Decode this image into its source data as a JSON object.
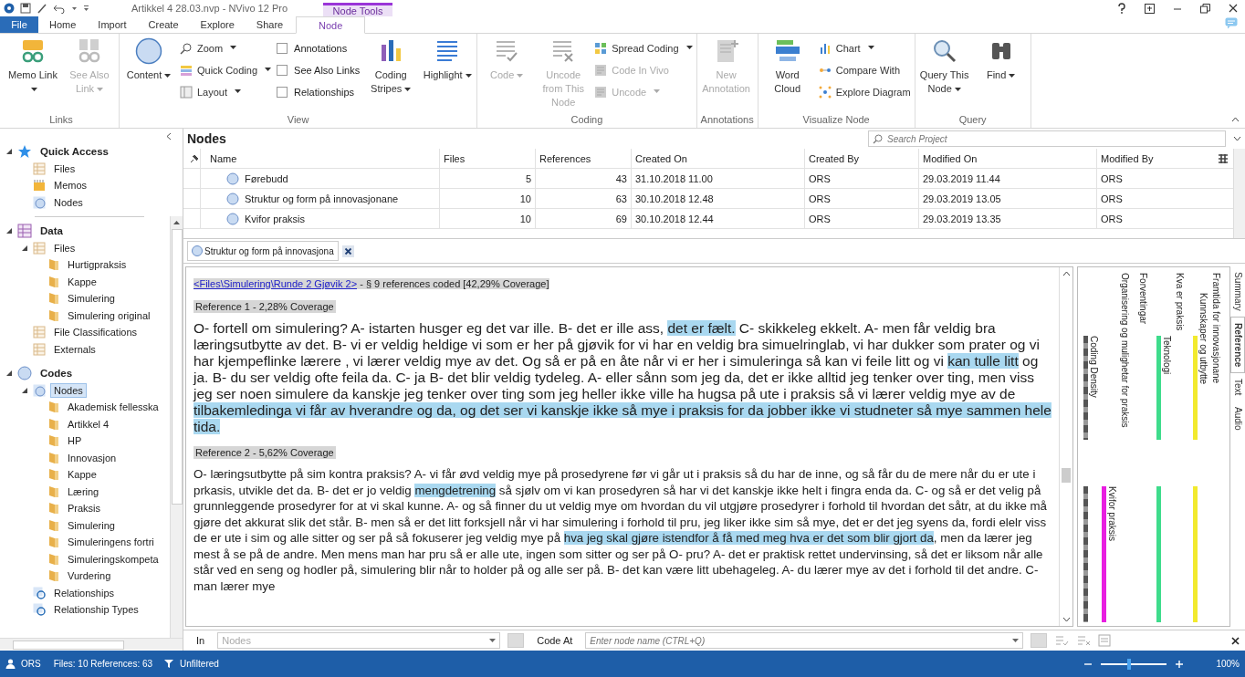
{
  "title_bar": {
    "title": "Artikkel 4 28.03.nvp - NVivo 12 Pro",
    "context_label": "Node Tools"
  },
  "tabs": [
    {
      "label": "File",
      "kind": "file",
      "selected": false
    },
    {
      "label": "Home",
      "kind": "normal",
      "selected": false
    },
    {
      "label": "Import",
      "kind": "normal",
      "selected": false
    },
    {
      "label": "Create",
      "kind": "normal",
      "selected": false
    },
    {
      "label": "Explore",
      "kind": "normal",
      "selected": false
    },
    {
      "label": "Share",
      "kind": "normal",
      "selected": false
    },
    {
      "label": "Node",
      "kind": "context",
      "selected": true
    }
  ],
  "ribbon": [
    {
      "label": "Links",
      "items": [
        {
          "kind": "large",
          "label": "Memo Link",
          "dropdown": true,
          "disabled": false
        },
        {
          "kind": "large",
          "label": "See Also Link",
          "dropdown": true,
          "disabled": true
        }
      ]
    },
    {
      "label": "View",
      "items": [
        {
          "kind": "large",
          "label": "Content",
          "dropdown": true,
          "disabled": false
        },
        {
          "kind": "stack",
          "items": [
            {
              "kind": "small",
              "label": "Zoom",
              "dropdown": true,
              "disabled": false
            },
            {
              "kind": "small",
              "label": "Quick Coding",
              "dropdown": true,
              "disabled": false
            },
            {
              "kind": "small",
              "label": "Layout",
              "dropdown": true,
              "disabled": false
            }
          ]
        },
        {
          "kind": "stack",
          "items": [
            {
              "kind": "check",
              "label": "Annotations",
              "checked": false
            },
            {
              "kind": "check",
              "label": "See Also Links",
              "checked": false
            },
            {
              "kind": "check",
              "label": "Relationships",
              "checked": false
            }
          ]
        },
        {
          "kind": "large",
          "label": "Coding Stripes",
          "dropdown": true,
          "disabled": false
        },
        {
          "kind": "large",
          "label": "Highlight",
          "dropdown": true,
          "disabled": false
        }
      ]
    },
    {
      "label": "Coding",
      "items": [
        {
          "kind": "large",
          "label": "Code",
          "dropdown": true,
          "disabled": true
        },
        {
          "kind": "large",
          "label": "Uncode from This Node",
          "dropdown": false,
          "disabled": true
        },
        {
          "kind": "stack",
          "items": [
            {
              "kind": "small",
              "label": "Spread Coding",
              "dropdown": true,
              "disabled": false
            },
            {
              "kind": "small",
              "label": "Code In Vivo",
              "dropdown": false,
              "disabled": true
            },
            {
              "kind": "small",
              "label": "Uncode",
              "dropdown": true,
              "disabled": true
            }
          ]
        }
      ]
    },
    {
      "label": "Annotations",
      "items": [
        {
          "kind": "large",
          "label": "New Annotation",
          "dropdown": false,
          "disabled": true
        }
      ]
    },
    {
      "label": "Visualize Node",
      "items": [
        {
          "kind": "large",
          "label": "Word Cloud",
          "dropdown": false,
          "disabled": false
        },
        {
          "kind": "stack",
          "items": [
            {
              "kind": "small",
              "label": "Chart",
              "dropdown": true,
              "disabled": false
            },
            {
              "kind": "small",
              "label": "Compare With",
              "dropdown": false,
              "disabled": false
            },
            {
              "kind": "small",
              "label": "Explore Diagram",
              "dropdown": false,
              "disabled": false
            }
          ]
        }
      ]
    },
    {
      "label": "Query",
      "items": [
        {
          "kind": "large",
          "label": "Query This Node",
          "dropdown": true,
          "disabled": false
        },
        {
          "kind": "large",
          "label": "Find",
          "dropdown": true,
          "disabled": false
        }
      ]
    }
  ],
  "navigation": [
    {
      "label": "Quick Access",
      "expanded": true,
      "selected": false,
      "children": [
        {
          "label": "Files",
          "selected": false
        },
        {
          "label": "Memos",
          "selected": false
        },
        {
          "label": "Nodes",
          "selected": false
        }
      ]
    },
    {
      "label": "Data",
      "expanded": true,
      "selected": false,
      "children": [
        {
          "label": "Files",
          "expanded": true,
          "selected": false,
          "children": [
            {
              "label": "Hurtigpraksis",
              "selected": false
            },
            {
              "label": "Kappe",
              "selected": false
            },
            {
              "label": "Simulering",
              "selected": false
            },
            {
              "label": "Simulering original",
              "selected": false
            }
          ]
        },
        {
          "label": "File Classifications",
          "selected": false
        },
        {
          "label": "Externals",
          "selected": false
        }
      ]
    },
    {
      "label": "Codes",
      "expanded": true,
      "selected": false,
      "children": [
        {
          "label": "Nodes",
          "expanded": true,
          "selected": true,
          "children": [
            {
              "label": "Akademisk fellesska",
              "selected": false
            },
            {
              "label": "Artikkel 4",
              "selected": false
            },
            {
              "label": "HP",
              "selected": false
            },
            {
              "label": "Innovasjon",
              "selected": false
            },
            {
              "label": "Kappe",
              "selected": false
            },
            {
              "label": "Læring",
              "selected": false
            },
            {
              "label": "Praksis",
              "selected": false
            },
            {
              "label": "Simulering",
              "selected": false
            },
            {
              "label": "Simuleringens fortri",
              "selected": false
            },
            {
              "label": "Simuleringskompeta",
              "selected": false
            },
            {
              "label": "Vurdering",
              "selected": false
            }
          ]
        },
        {
          "label": "Relationships",
          "selected": false
        },
        {
          "label": "Relationship Types",
          "selected": false
        }
      ]
    }
  ],
  "nodes_panel": {
    "title": "Nodes",
    "search_placeholder": "Search Project",
    "columns": [
      "Name",
      "Files",
      "References",
      "Created On",
      "Created By",
      "Modified On",
      "Modified By"
    ],
    "rows": [
      {
        "name": "Førebudd",
        "files": "5",
        "references": "43",
        "created_on": "31.10.2018 11.00",
        "created_by": "ORS",
        "modified_on": "29.03.2019 11.44",
        "modified_by": "ORS",
        "selected": false
      },
      {
        "name": "Struktur og form på innovasjonane",
        "files": "10",
        "references": "63",
        "created_on": "30.10.2018 12.48",
        "created_by": "ORS",
        "modified_on": "29.03.2019 13.05",
        "modified_by": "ORS",
        "selected": false
      },
      {
        "name": "Kvifor praksis",
        "files": "10",
        "references": "69",
        "created_on": "30.10.2018 12.44",
        "created_by": "ORS",
        "modified_on": "29.03.2019 13.35",
        "modified_by": "ORS",
        "selected": false
      }
    ]
  },
  "document_tab": {
    "label": "Struktur og form på innovasjona",
    "selected": true
  },
  "document": {
    "source_link": "<Files\\Simulering\\Runde 2 Gjøvik 2>",
    "summary": " - § 9 references coded  [42,29% Coverage]",
    "references": [
      {
        "heading": "Reference 1 - 2,28% Coverage",
        "segments": [
          {
            "text": "O- fortell om simulering? A- istarten husger eg det var ille. B- det er ille ass, ",
            "highlighted": false
          },
          {
            "text": "det er fælt.",
            "highlighted": true
          },
          {
            "text": " C- skikkeleg ekkelt. A- men får veldig bra læringsutbytte av det. B- vi er veldig heldige vi som er her på gjøvik for vi har en veldig bra simuelringlab, vi har dukker som prater og vi har kjempeflinke lærere , vi lærer veldig mye av det. Og så er på en åte når vi er her i simuleringa så kan vi feile litt og vi ",
            "highlighted": false
          },
          {
            "text": "kan tulle litt",
            "highlighted": true
          },
          {
            "text": " og ja. B- du ser veldig ofte feila da. C- ja B- det blir veldig tydeleg. A- eller sånn som jeg da, det er ikke alltid jeg tenker over ting, men viss jeg ser noen simulere da kanskje jeg tenker over ting som jeg heller ikke ville ha hugsa på ute i praksis så vi lærer veldig mye av de ",
            "highlighted": false
          },
          {
            "text": "tilbakemledinga vi får av hverandre og da, og det ser vi kanskje ikke så mye i praksis for da jobber ikke vi studneter så mye sammen hele tida.",
            "highlighted": true
          }
        ]
      },
      {
        "heading": "Reference 2 - 5,62% Coverage",
        "segments": [
          {
            "text": "O- læringsutbytte på sim kontra praksis? A- vi får øvd veldig mye på prosedyrene før vi går ut i praksis så du har de inne, og så får du de mere når du er ute i prkasis, utvikle det da. B- det er jo veldig ",
            "highlighted": false
          },
          {
            "text": "mengdetrening",
            "highlighted": true
          },
          {
            "text": " så sjølv om vi kan prosedyren så har vi det kanskje ikke helt i fingra enda da. C- og så er det velig på grunnleggende prosedyrer for at vi skal kunne. A- og så finner du ut veldig mye om hvordan du vil utgjøre prosedyrer i forhold til hvordan det såtr, at du ikke må gjøre det akkurat slik det står. B- men så er det litt forksjell når vi har simulering i forhold til pru, jeg liker ikke sim så mye, det er det jeg syens da, fordi elelr viss de er ute i sim og alle sitter og ser på så fokuserer jeg veldig mye på ",
            "highlighted": false
          },
          {
            "text": "hva jeg skal gjøre istendfor å få med meg hva er det som blir gjort da",
            "highlighted": true
          },
          {
            "text": ", men da lærer jeg mest å se på de andre. Men mens man har pru så er alle ute, ingen som sitter og ser på O- pru? A- det er praktisk rettet undervinsing, så det er liksom når alle står ved en seng og hodler på, simulering blir når to holder på og alle ser på. B- det kan være litt ubehageleg. A- du lærer mye av det i forhold til det andre. C- man lærer mye",
            "highlighted": false
          }
        ]
      }
    ]
  },
  "coding_stripes": [
    {
      "label": "Coding Density",
      "kind": "density"
    },
    {
      "label": "Kvifor praksis",
      "kind": "stripe",
      "color": "#e81ee0"
    },
    {
      "label": "Organisering og mulighetar for praksis",
      "kind": "heading"
    },
    {
      "label": "Forventingar",
      "kind": "heading"
    },
    {
      "label": "Teknologi",
      "kind": "stripe",
      "color": "#3edc8c"
    },
    {
      "label": "Kva er praksis",
      "kind": "heading"
    },
    {
      "label": "Kunnskaper og utbytte",
      "kind": "stripe",
      "color": "#f2ea2e"
    },
    {
      "label": "Framtida for innovasjonane",
      "kind": "heading"
    }
  ],
  "side_tabs": [
    {
      "label": "Summary",
      "selected": false
    },
    {
      "label": "Reference",
      "selected": true
    },
    {
      "label": "Text",
      "selected": false
    },
    {
      "label": "Audio",
      "selected": false
    }
  ],
  "find_bar": {
    "in_label": "In",
    "in_value": "Nodes",
    "code_at_label": "Code At",
    "node_placeholder": "Enter node name (CTRL+Q)"
  },
  "status_bar": {
    "user": "ORS",
    "counts": "Files: 10 References: 63",
    "filter": "Unfiltered",
    "zoom": {
      "level": 0.42
    },
    "zoom_label": "100%"
  }
}
